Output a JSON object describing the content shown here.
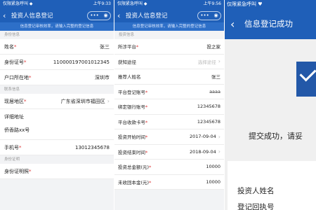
{
  "colors": {
    "brand_blue": "#1f5fb8",
    "required_red": "#d33333"
  },
  "p1": {
    "status_left": "仅限紧急呼叫 ◆",
    "status_right": "上午9:33",
    "title": "投资人信息登记",
    "capsule_dots": "•••",
    "capsule_icon": "target-icon",
    "notice": "信息登记审核效率，请输入完整的登记信息",
    "section1": "身份信息",
    "rows": [
      {
        "label": "姓名",
        "value": "张三"
      },
      {
        "label": "身份证号",
        "value": "110000197001012345"
      },
      {
        "label": "户口所在地",
        "value": "深圳市"
      }
    ],
    "section2": "联系信息",
    "address_label": "现居地区",
    "address_value": "广东省深圳市福田区",
    "detail_label": "详细地址",
    "detail_value": "侨香路xx号",
    "phone_label": "手机号",
    "phone_value": "13012345678",
    "section3": "身份证明",
    "id_label": "身份证明照",
    "back_icon": "back-arrow-icon",
    "chevron_icon": "chevron-right-icon"
  },
  "p2": {
    "status_left": "仅限紧急呼叫 ◆",
    "status_right": "上午9:56",
    "title": "投资人信息登记",
    "notice": "信息登记审核效率，请输入完整的登记信息",
    "section1": "投资信息",
    "rows": [
      {
        "label": "所涉平台",
        "req": true,
        "value": "投之家",
        "chevron": false
      },
      {
        "label": "获知途径",
        "req": false,
        "value": "选择途径",
        "placeholder": true,
        "chevron": true
      },
      {
        "label": "推荐人姓名",
        "req": false,
        "value": "张三",
        "chevron": false
      },
      {
        "label": "平台登记账号",
        "req": true,
        "value": "aaaa",
        "chevron": false
      },
      {
        "label": "绑定银行账号",
        "req": true,
        "value": "12345678",
        "chevron": false
      },
      {
        "label": "平台收款卡号",
        "req": true,
        "value": "12345678",
        "chevron": false
      },
      {
        "label": "投资开始时间",
        "req": true,
        "value": "2017-09-04",
        "chevron": true
      },
      {
        "label": "投资结束时间",
        "req": true,
        "value": "2018-09-04",
        "chevron": true
      },
      {
        "label": "投资总金额(元)",
        "req": true,
        "value": "10000",
        "chevron": false
      },
      {
        "label": "未收回本金(元)",
        "req": true,
        "value": "10000",
        "chevron": false
      }
    ]
  },
  "p3": {
    "status_left": "仅限紧急呼叫 ♥",
    "title": "信息登记成功",
    "success_text": "提交成功，请妥",
    "card_line1": "投资人姓名",
    "card_line2": "登记回执号",
    "hero_icon": "envelope-check-icon"
  }
}
